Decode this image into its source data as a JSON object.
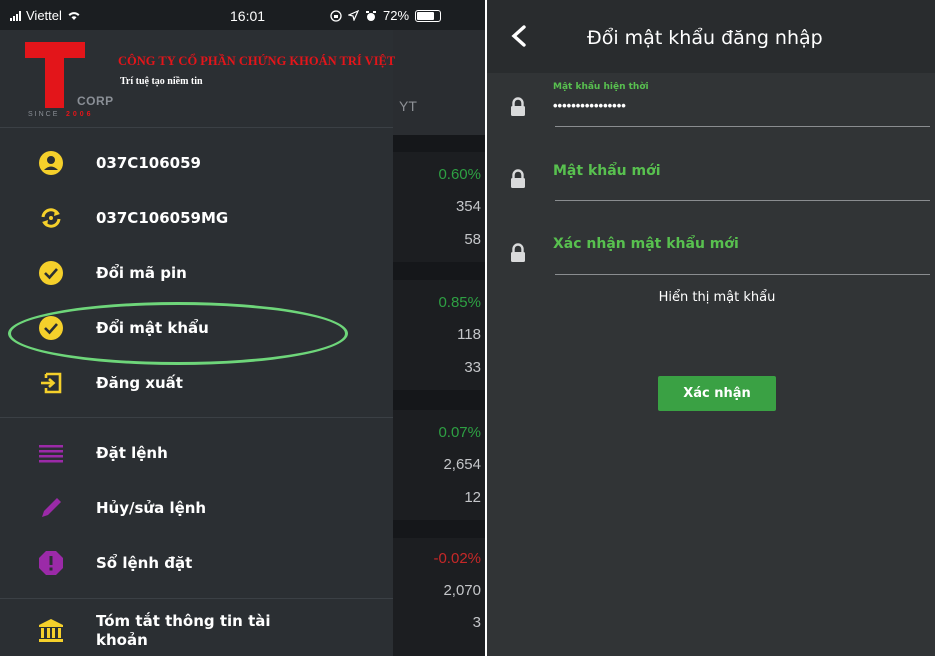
{
  "status_bar": {
    "carrier": "Viettel",
    "time": "16:01",
    "battery": "72%"
  },
  "drawer": {
    "company_name": "CÔNG TY CỔ PHẦN CHỨNG KHOÁN TRÍ VIỆT",
    "slogan": "Trí tuệ tạo niềm tin",
    "logo_corp": "CORP",
    "logo_since": "SINCE",
    "logo_year": "2006",
    "items": [
      {
        "label": "037C106059",
        "icon": "user-icon",
        "color": "#f5d02b"
      },
      {
        "label": "037C106059MG",
        "icon": "switch-account-icon",
        "color": "#f5d02b"
      },
      {
        "label": "Đổi mã pin",
        "icon": "check-circle-icon",
        "color": "#f5d02b"
      },
      {
        "label": "Đổi mật khẩu",
        "icon": "check-circle-icon",
        "color": "#f5d02b"
      },
      {
        "label": "Đăng xuất",
        "icon": "logout-icon",
        "color": "#f5d02b"
      },
      {
        "label": "Đặt lệnh",
        "icon": "list-icon",
        "color": "#9b2aa8"
      },
      {
        "label": "Hủy/sửa lệnh",
        "icon": "pencil-icon",
        "color": "#9b2aa8"
      },
      {
        "label": "Sổ lệnh đặt",
        "icon": "alert-octagon-icon",
        "color": "#9b2aa8"
      },
      {
        "label": "Tóm tắt thông tin tài khoản",
        "icon": "bank-icon",
        "color": "#f5d02b"
      }
    ]
  },
  "background": {
    "header_label": "YT",
    "rows": [
      {
        "pct": "0.60%",
        "v1": "354",
        "v2": "58",
        "pct_color": "#2ea043"
      },
      {
        "pct": "0.85%",
        "v1": "118",
        "v2": "33",
        "pct_color": "#2ea043"
      },
      {
        "pct": "0.07%",
        "v1": "2,654",
        "v2": "12",
        "pct_color": "#2ea043"
      },
      {
        "pct": "-0.02%",
        "v1": "2,070",
        "v2": "3",
        "pct_color": "#c62828"
      }
    ]
  },
  "change_password": {
    "title": "Đổi mật khẩu đăng nhập",
    "current_label": "Mật khẩu hiện thời",
    "current_value": "••••••••••••••••",
    "new_label": "Mật khẩu mới",
    "confirm_label": "Xác nhận mật khẩu mới",
    "show_password": "Hiển thị mật khẩu",
    "submit": "Xác nhận",
    "accent_color": "#58c04f"
  }
}
